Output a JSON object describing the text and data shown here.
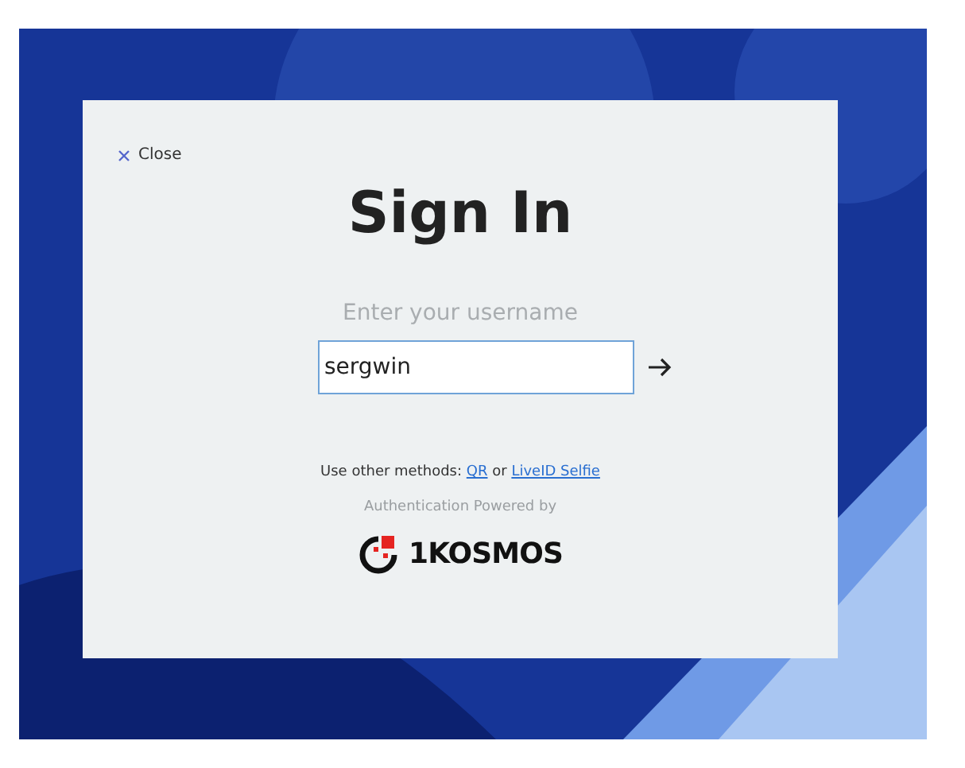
{
  "dialog": {
    "close_label": "Close",
    "title": "Sign In",
    "username_label": "Enter your username",
    "username_value": "sergwin",
    "other_methods": {
      "prefix": "Use other methods:",
      "joiner": "or",
      "links": [
        {
          "label": "QR"
        },
        {
          "label": "LiveID Selfie"
        }
      ]
    },
    "powered_by": "Authentication Powered by",
    "logo_text": "1KOSMOS"
  }
}
